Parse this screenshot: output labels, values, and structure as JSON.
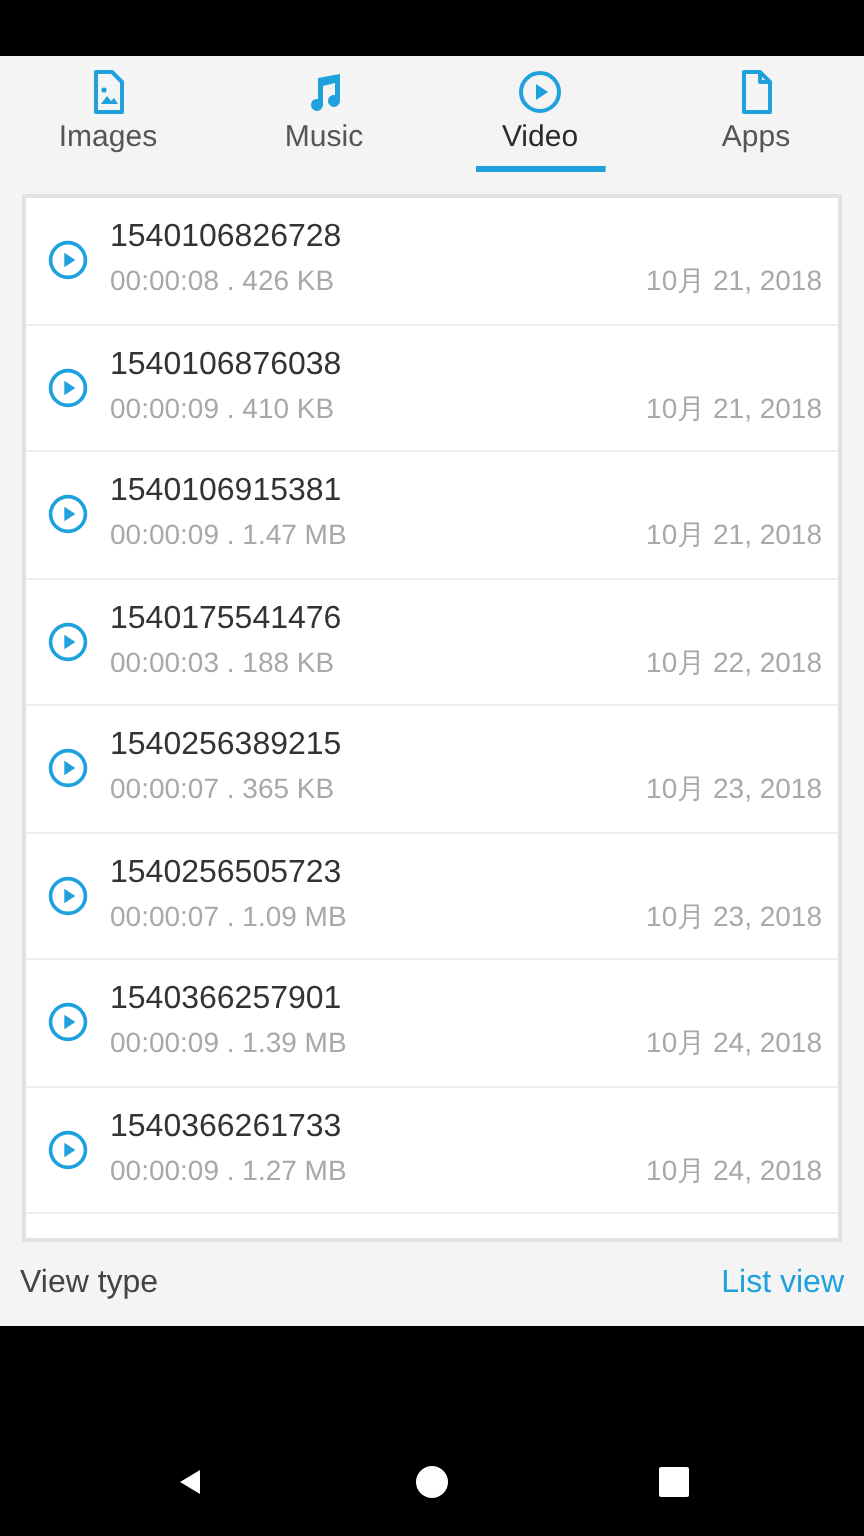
{
  "tabs": [
    {
      "kind": "image",
      "label": "Images",
      "selected": false
    },
    {
      "kind": "music",
      "label": "Music",
      "selected": false
    },
    {
      "kind": "video",
      "label": "Video",
      "selected": true
    },
    {
      "kind": "file",
      "label": "Apps",
      "selected": false
    }
  ],
  "files": [
    {
      "name": "1540106826728",
      "details": "00:00:08 . 426 KB",
      "date": "10月 21, 2018"
    },
    {
      "name": "1540106876038",
      "details": "00:00:09 . 410 KB",
      "date": "10月 21, 2018"
    },
    {
      "name": "1540106915381",
      "details": "00:00:09 . 1.47 MB",
      "date": "10月 21, 2018"
    },
    {
      "name": "1540175541476",
      "details": "00:00:03 . 188 KB",
      "date": "10月 22, 2018"
    },
    {
      "name": "1540256389215",
      "details": "00:00:07 . 365 KB",
      "date": "10月 23, 2018"
    },
    {
      "name": "1540256505723",
      "details": "00:00:07 . 1.09 MB",
      "date": "10月 23, 2018"
    },
    {
      "name": "1540366257901",
      "details": "00:00:09 . 1.39 MB",
      "date": "10月 24, 2018"
    },
    {
      "name": "1540366261733",
      "details": "00:00:09 . 1.27 MB",
      "date": "10月 24, 2018"
    }
  ],
  "footer": {
    "label": "View type",
    "value": "List view"
  }
}
